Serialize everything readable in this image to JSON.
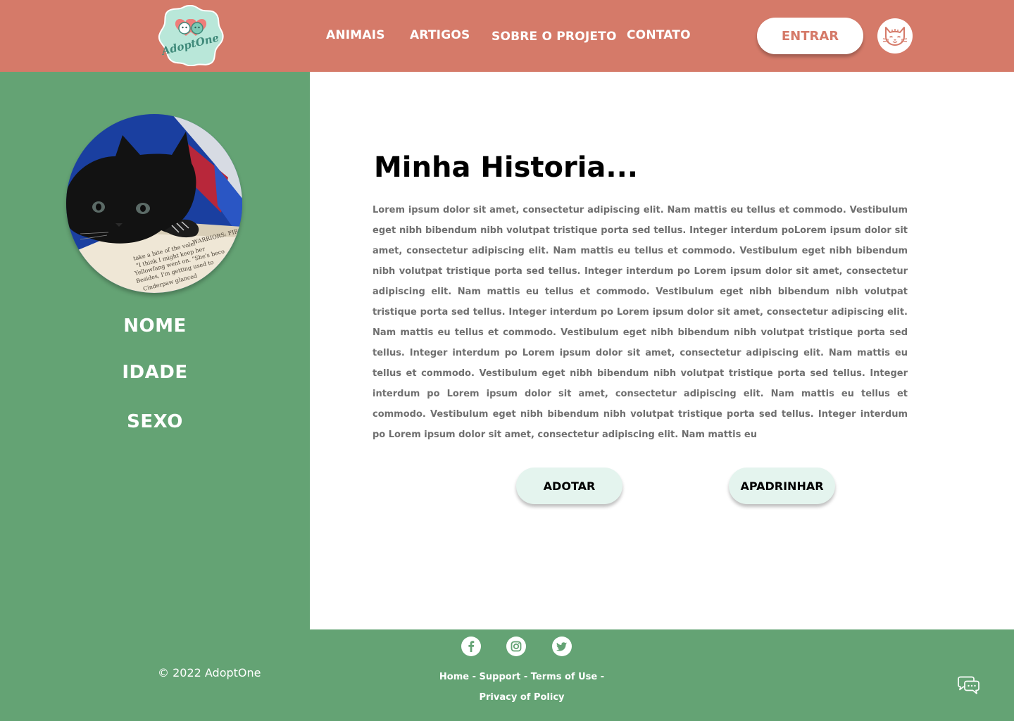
{
  "brand": {
    "logo_text": "AdoptOne"
  },
  "nav": {
    "items": [
      {
        "label": "ANIMAIS"
      },
      {
        "label": "ARTIGOS"
      },
      {
        "label": "SOBRE O PROJETO"
      },
      {
        "label": "CONTATO"
      }
    ],
    "login_label": "ENTRAR"
  },
  "pet": {
    "name_label": "NOME",
    "age_label": "IDADE",
    "sex_label": "SEXO",
    "book_text": [
      "WARRIORS: FIRE AND",
      "take a bite of the vole.",
      "\"I think I might keep her",
      "Yellowfang went on. \"She's beco",
      "Besides, I'm getting used to",
      "Cinderpaw glanced"
    ]
  },
  "story": {
    "title": "Minha Historia...",
    "body": "Lorem ipsum dolor sit amet, consectetur adipiscing elit. Nam mattis eu tellus et commodo. Vestibulum eget nibh bibendum nibh volutpat tristique porta sed tellus. Integer interdum poLorem ipsum dolor sit amet, consectetur adipiscing elit. Nam mattis eu tellus et commodo. Vestibulum eget nibh bibendum nibh volutpat tristique porta sed tellus. Integer interdum po Lorem ipsum dolor sit amet, consectetur adipiscing elit. Nam mattis eu tellus et commodo. Vestibulum eget nibh bibendum nibh volutpat tristique porta sed tellus. Integer interdum po Lorem ipsum dolor sit amet, consectetur adipiscing elit. Nam mattis eu tellus et commodo. Vestibulum eget nibh bibendum nibh volutpat tristique porta sed tellus. Integer interdum po Lorem ipsum dolor sit amet, consectetur adipiscing elit. Nam mattis eu tellus et commodo. Vestibulum eget nibh bibendum nibh volutpat tristique porta sed tellus. Integer interdum po Lorem ipsum dolor sit amet, consectetur adipiscing elit. Nam mattis eu tellus et commodo. Vestibulum eget nibh bibendum nibh volutpat tristique porta sed tellus. Integer interdum po Lorem ipsum dolor sit amet, consectetur adipiscing elit. Nam mattis eu"
  },
  "actions": {
    "adopt_label": "ADOTAR",
    "sponsor_label": "APADRINHAR"
  },
  "footer": {
    "copyright": "© 2022 AdoptOne",
    "social_icons": [
      "facebook-icon",
      "instagram-icon",
      "twitter-icon"
    ],
    "links": {
      "home": "Home",
      "support": "Support",
      "terms": "Terms of Use",
      "privacy": "Privacy of Policy",
      "separator": " - "
    }
  },
  "colors": {
    "header": "#d57a69",
    "sidebar": "#64a374",
    "button_light": "#e4f4ee",
    "logo_bg": "#b9e7d9"
  }
}
